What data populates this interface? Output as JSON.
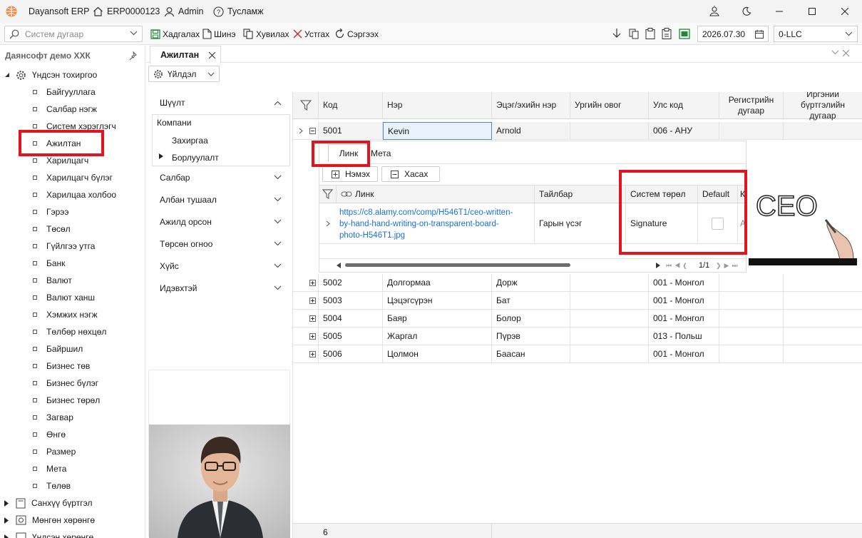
{
  "titlebar": {
    "app": "Dayansoft ERP",
    "code": "ERP0000123",
    "user": "Admin",
    "help": "Тусламж"
  },
  "toolbar": {
    "search_placeholder": "Систем дугаар",
    "save": "Хадгалах",
    "new": "Шинэ",
    "copy": "Хувилах",
    "delete": "Устгах",
    "refresh": "Сэргээх",
    "date": "2026.07.30",
    "company": "0-LLC"
  },
  "nav": {
    "company": "Даянсофт демо ХХК",
    "root": "Үндсэн тохиргоо",
    "items": [
      "Байгууллага",
      "Салбар нэгж",
      "Систем хэрэглэгч",
      "Ажилтан",
      "Харилцагч",
      "Харилцагч бүлэг",
      "Харилцаа холбоо",
      "Гэрээ",
      "Төсөл",
      "Гүйлгээ утга",
      "Банк",
      "Валют",
      "Валют ханш",
      "Хэмжих нэгж",
      "Төлбөр нөхцөл",
      "Байршил",
      "Бизнес төв",
      "Бизнес бүлэг",
      "Бизнес төрөл",
      "Загвар",
      "Өнгө",
      "Размер",
      "Мета",
      "Төлөв"
    ],
    "groups": [
      "Санхүү бүртгэл",
      "Мөнгөн хөрөнгө",
      "Үндсэн хөрөнгө"
    ]
  },
  "tab": {
    "label": "Ажилтан"
  },
  "actions": {
    "label": "Үйлдэл"
  },
  "filter": {
    "title": "Шүүлт",
    "tree": [
      "Компани",
      "Захиргаа",
      "Борлуулалт"
    ],
    "sections": [
      "Салбар",
      "Албан тушаал",
      "Ажилд орсон",
      "Төрсөн огноо",
      "Хүйс",
      "Идэвхтэй"
    ]
  },
  "grid": {
    "columns": [
      "Код",
      "Нэр",
      "Эцэг/эхийн нэр",
      "Ургийн овог",
      "Улс код",
      "Регистрийн дугаар",
      "Иргэний бүртгэлийн дугаар"
    ],
    "rows": [
      {
        "code": "5001",
        "name": "Kevin",
        "father": "Arnold",
        "country": "006 - АНУ"
      },
      {
        "code": "5002",
        "name": "Долгормаа",
        "father": "Дорж",
        "country": "001 - Монгол"
      },
      {
        "code": "5003",
        "name": "Цэцэгсүрэн",
        "father": "Бат",
        "country": "001 - Монгол"
      },
      {
        "code": "5004",
        "name": "Баяр",
        "father": "Болор",
        "country": "001 - Монгол"
      },
      {
        "code": "5005",
        "name": "Жаргал",
        "father": "Пүрэв",
        "country": "013 - Польш"
      },
      {
        "code": "5006",
        "name": "Цолмон",
        "father": "Баасан",
        "country": "001 - Монгол"
      }
    ],
    "count": "6"
  },
  "detail": {
    "tabs": [
      "Линк",
      "Мета"
    ],
    "add": "Нэмэх",
    "remove": "Хасах",
    "columns": [
      "Линк",
      "Тайлбар",
      "Систем төрөл",
      "Default"
    ],
    "link": "https://c8.alamy.com/comp/H546T1/ceo-written-by-hand-hand-writing-on-transparent-board-photo-H546T1.jpg",
    "link_lines": [
      "https://c8.alamy.com/comp/H546T1/ceo-written-",
      "by-hand-hand-writing-on-transparent-board-",
      "photo-H546T1.jpg"
    ],
    "desc": "Гарын үсэг",
    "systype": "Signature",
    "pager": "1/1"
  },
  "preview": {
    "signature_text": "CEO"
  }
}
